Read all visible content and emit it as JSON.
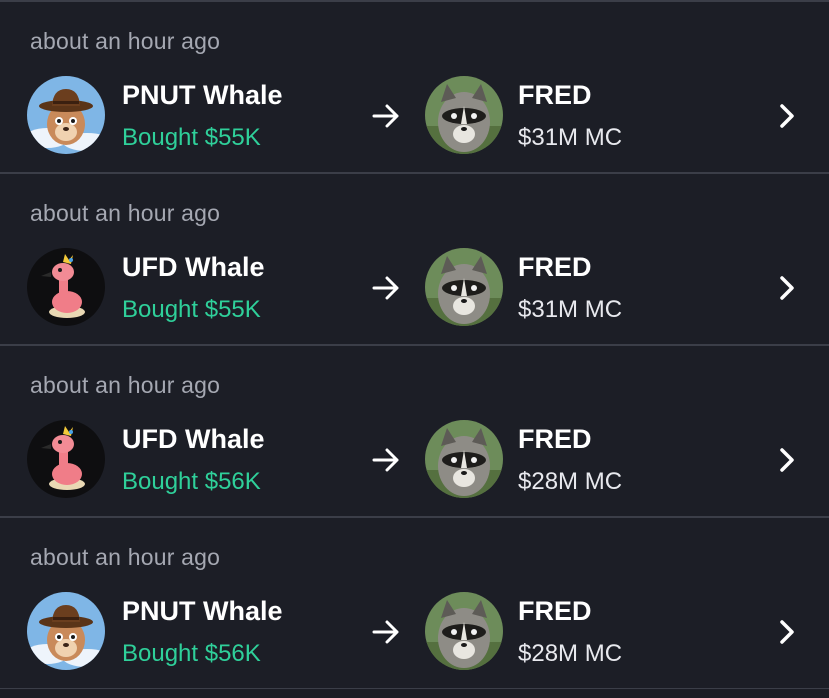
{
  "trades": [
    {
      "time": "about an hour ago",
      "trader_name": "PNUT Whale",
      "trader_icon": "pnut-squirrel-cowboy-icon",
      "action_text": "Bought $55K",
      "token_name": "FRED",
      "token_icon": "raccoon-icon",
      "market_cap": "$31M MC"
    },
    {
      "time": "about an hour ago",
      "trader_name": "UFD Whale",
      "trader_icon": "ufd-pink-flamingo-icon",
      "action_text": "Bought $55K",
      "token_name": "FRED",
      "token_icon": "raccoon-icon",
      "market_cap": "$31M MC"
    },
    {
      "time": "about an hour ago",
      "trader_name": "UFD Whale",
      "trader_icon": "ufd-pink-flamingo-icon",
      "action_text": "Bought $56K",
      "token_name": "FRED",
      "token_icon": "raccoon-icon",
      "market_cap": "$28M MC"
    },
    {
      "time": "about an hour ago",
      "trader_name": "PNUT Whale",
      "trader_icon": "pnut-squirrel-cowboy-icon",
      "action_text": "Bought $56K",
      "token_name": "FRED",
      "token_icon": "raccoon-icon",
      "market_cap": "$28M MC"
    }
  ],
  "colors": {
    "background": "#1c1e26",
    "divider": "#3b3e48",
    "buy_green": "#2fd09a",
    "muted_text": "#a5a8b2"
  }
}
